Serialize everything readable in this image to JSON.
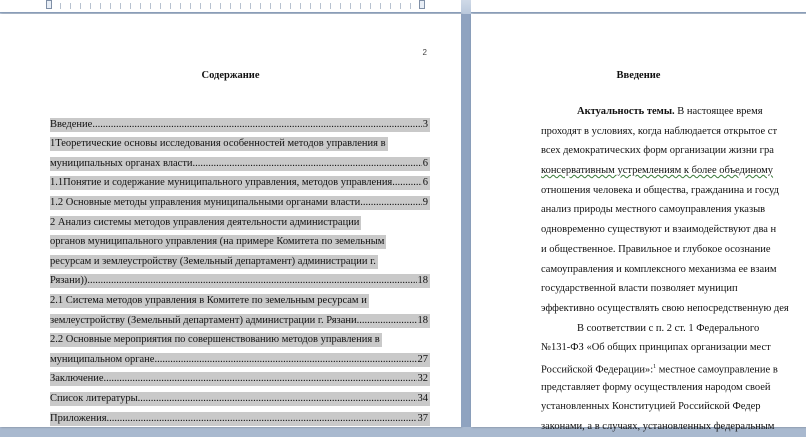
{
  "left_page": {
    "page_number": "2",
    "heading": "Содержание",
    "toc": [
      {
        "text": "Введение",
        "page": "3",
        "continued": null
      },
      {
        "text": "1Теоретические основы исследования  особенностей методов управления в",
        "page": "",
        "continued": null
      },
      {
        "text": "муниципальных органах власти",
        "page": "6",
        "continued": null
      },
      {
        "text": "1.1Понятие и содержание муниципального управления, методов управления",
        "page": "6",
        "continued": null
      },
      {
        "text": "1.2 Основные методы управления муниципальными органами власти",
        "page": "9",
        "continued": null
      },
      {
        "text": "2  Анализ   системы методов управления  деятельности администрации",
        "page": "",
        "continued": null
      },
      {
        "text": "органов муниципального управления (на примере Комитета по земельным",
        "page": "",
        "continued": null
      },
      {
        "text": "ресурсам и землеустройству (Земельный департамент)  администрации г.",
        "page": "",
        "continued": null
      },
      {
        "text": "Рязани))",
        "page": "18",
        "continued": null
      },
      {
        "text": "2.1    Система методов управления  в Комитете по земельным ресурсам и",
        "page": "",
        "continued": null
      },
      {
        "text": "землеустройству (Земельный департамент)  администрации г. Рязани",
        "page": "18",
        "continued": null
      },
      {
        "text": "2.2 Основные мероприятия по совершенствованию методов  управления в",
        "page": "",
        "continued": null
      },
      {
        "text": "муниципальном органе",
        "page": "27",
        "continued": null
      },
      {
        "text": "Заключение",
        "page": "32",
        "continued": null
      },
      {
        "text": "Список литературы",
        "page": "34",
        "continued": null
      },
      {
        "text": "Приложения",
        "page": "37",
        "continued": null
      }
    ]
  },
  "right_page": {
    "heading": "Введение",
    "lines": [
      {
        "bold": "Актуальность  темы.",
        "text": "   В  настоящее  время",
        "indent": true
      },
      {
        "bold": "",
        "text": "проходят в условиях, когда  наблюдается открытое ст",
        "indent": false
      },
      {
        "bold": "",
        "text": "всех  демократических форм организации жизни   гра",
        "indent": false
      },
      {
        "bold": "",
        "text": "консервативным устремлениям к  более  объединому",
        "indent": false
      },
      {
        "bold": "",
        "text": "отношения человека и общества, гражданина и госуд",
        "indent": false
      },
      {
        "bold": "",
        "text": "анализ природы местного   самоуправления   указыв",
        "indent": false
      },
      {
        "bold": "",
        "text": "одновременно   существуют и взаимодействуют два н",
        "indent": false
      },
      {
        "bold": "",
        "text": "и общественное. Правильное и глубокое осознание",
        "indent": false
      },
      {
        "bold": "",
        "text": "самоуправления и  комплексного механизма ее взаим",
        "indent": false
      },
      {
        "bold": "",
        "text": "государственной       власти   позволяет       муницип",
        "indent": false
      },
      {
        "bold": "",
        "text": "эффективно осуществлять свою непосредственную дея",
        "indent": false
      },
      {
        "bold": "",
        "text": "В  соответствии  с  п.  2  ст.  1  Федерального",
        "indent": true
      },
      {
        "bold": "",
        "text": "№131-ФЗ «Об  общих  принципах организации  мест",
        "indent": false
      },
      {
        "bold": "",
        "text": "Российской Федерации»:",
        "sup": "1",
        "tail": "  местное самоуправление в",
        "indent": false
      },
      {
        "bold": "",
        "text": "представляет  форму  осуществления  народом  своей",
        "indent": false
      },
      {
        "bold": "",
        "text": "установленных   Конституцией   Российской   Федер",
        "indent": false
      },
      {
        "bold": "",
        "text": "законами, а в случаях, установленных федеральным",
        "indent": false
      }
    ]
  }
}
